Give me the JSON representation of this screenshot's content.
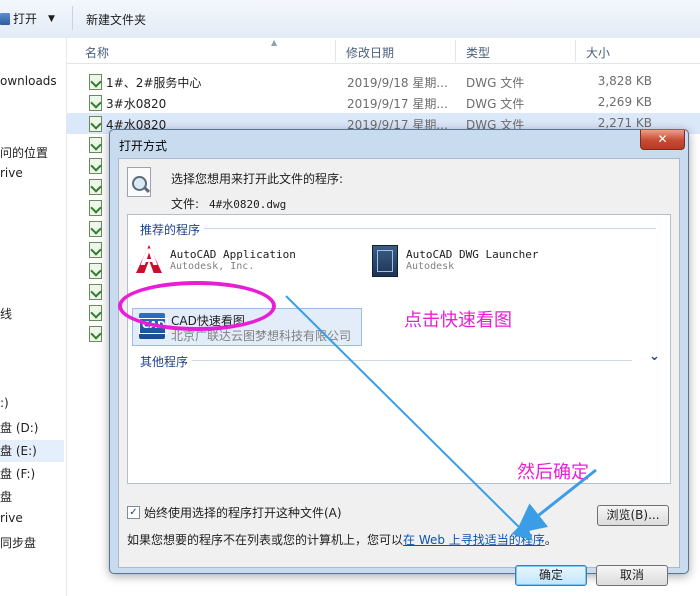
{
  "toolbar": {
    "open_label": "打开",
    "new_folder_label": "新建文件夹"
  },
  "nav": [
    "ownloads",
    "问的位置",
    "rive",
    "线",
    ":)",
    "盘 (D:)",
    "盘 (E:)",
    "盘 (F:)",
    "盘",
    "rive",
    "同步盘"
  ],
  "columns": {
    "name": "名称",
    "date": "修改日期",
    "type": "类型",
    "size": "大小"
  },
  "files": [
    {
      "name": "1#、2#服务中心",
      "date": "2019/9/18 星期...",
      "type": "DWG 文件",
      "size": "3,828 KB"
    },
    {
      "name": "3#水0820",
      "date": "2019/9/17 星期...",
      "type": "DWG 文件",
      "size": "2,269 KB"
    },
    {
      "name": "4#水0820",
      "date": "2019/9/17 星期...",
      "type": "DWG 文件",
      "size": "2,271 KB"
    }
  ],
  "dialog": {
    "title": "打开方式",
    "close_label": "✕",
    "prompt": "选择您想用来打开此文件的程序:",
    "file_label": "文件:",
    "file_name": "4#水0820.dwg",
    "recommended_title": "推荐的程序",
    "programs": [
      {
        "name": "AutoCAD Application",
        "vendor": "Autodesk, Inc."
      },
      {
        "name": "AutoCAD DWG Launcher",
        "vendor": "Autodesk"
      },
      {
        "name": "CAD快速看图",
        "vendor": "北京广联达云图梦想科技有限公司"
      }
    ],
    "other_title": "其他程序",
    "always_use_label": "始终使用选择的程序打开这种文件(A)",
    "always_use_checked": "✓",
    "browse_label": "浏览(B)...",
    "hint_text": "如果您想要的程序不在列表或您的计算机上，您可以",
    "hint_link": "在 Web 上寻找适当的程序",
    "hint_end": "。",
    "ok_label": "确定",
    "cancel_label": "取消"
  },
  "annotations": {
    "click_hint": "点击快速看图",
    "confirm_hint": "然后确定",
    "color": "#e81ed6",
    "arrow_color": "#3b9de6"
  },
  "icons": {
    "cad_logo_text": "CAD",
    "autocad_logo_text": "A"
  }
}
